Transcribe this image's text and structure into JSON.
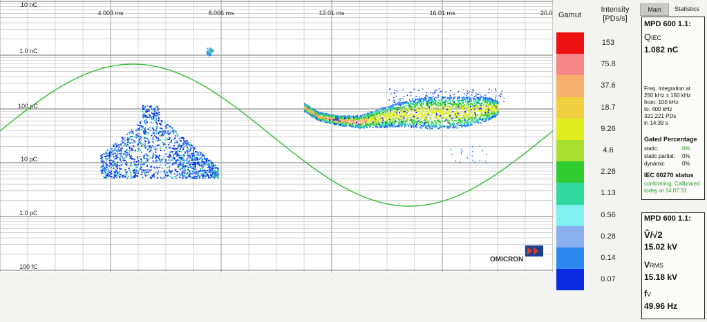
{
  "plot": {
    "x_ticks": [
      "4.003 ms",
      "8.006 ms",
      "12.01 ms",
      "16.01 ms",
      "20.0"
    ],
    "y_ticks": [
      "10 nC",
      "1.0 nC",
      "100 pC",
      "10 pC",
      "1.0 pC",
      "100 fC"
    ],
    "logo_text": "OMICRON",
    "colors": {
      "sine": "#3cbf3c",
      "background": "#ffffff",
      "grid": "#b9b9b9"
    }
  },
  "chart_data": {
    "type": "scatter",
    "title": "",
    "x_unit": "ms",
    "y_scale": "log",
    "x_range": [
      0,
      20.0
    ],
    "y_range_labels": [
      "100 fC",
      "10 nC"
    ],
    "series": [],
    "grid": true
  },
  "gamut": {
    "title": "Gamut",
    "intensity_label": "Intensity",
    "intensity_unit": "[PDs/s]",
    "levels": [
      {
        "value": "153",
        "color": "#ee1111"
      },
      {
        "value": "75.8",
        "color": "#f88888"
      },
      {
        "value": "37.6",
        "color": "#f8b070"
      },
      {
        "value": "18.7",
        "color": "#f0d040"
      },
      {
        "value": "9.26",
        "color": "#e0ee20"
      },
      {
        "value": "4.6",
        "color": "#a8e030"
      },
      {
        "value": "2.28",
        "color": "#30cc30"
      },
      {
        "value": "1.13",
        "color": "#30d8a0"
      },
      {
        "value": "0.56",
        "color": "#80f0f0"
      },
      {
        "value": "0.28",
        "color": "#8ab0f0"
      },
      {
        "value": "0.14",
        "color": "#2a88ee"
      },
      {
        "value": "0.07",
        "color": "#0a2ae0"
      }
    ]
  },
  "panel": {
    "tabs": {
      "main": "Main",
      "statistics": "Statistics"
    },
    "box1": {
      "device": "MPD 600 1.1:",
      "q_label": "Q",
      "q_sub": "IEC",
      "q_value": "1.082 nC",
      "freq_lines": [
        "Freq. integration at",
        "250 kHz ± 150 kHz",
        "from:  100 kHz",
        "to:     400 kHz",
        "321,221 PDs",
        "in 14.39 s"
      ],
      "gated_title": "Gated Percentage",
      "gated": [
        {
          "label": "static:",
          "value": "0%"
        },
        {
          "label": "static partial:",
          "value": "0%"
        },
        {
          "label": "dynamic",
          "value": "0%"
        }
      ],
      "iec_title": "IEC 60270 status",
      "iec_lines": [
        "conforming. Calibrated",
        "today at 14:07:31"
      ]
    },
    "box2": {
      "device": "MPD 600 1.1:",
      "vpeak_label": "V̂/√2",
      "vpeak_value": "15.02 kV",
      "vrms_label": "V",
      "vrms_sub": "RMS",
      "vrms_value": "15.18 kV",
      "f_label": "f",
      "f_sub": "V",
      "f_value": "49.96 Hz"
    }
  }
}
